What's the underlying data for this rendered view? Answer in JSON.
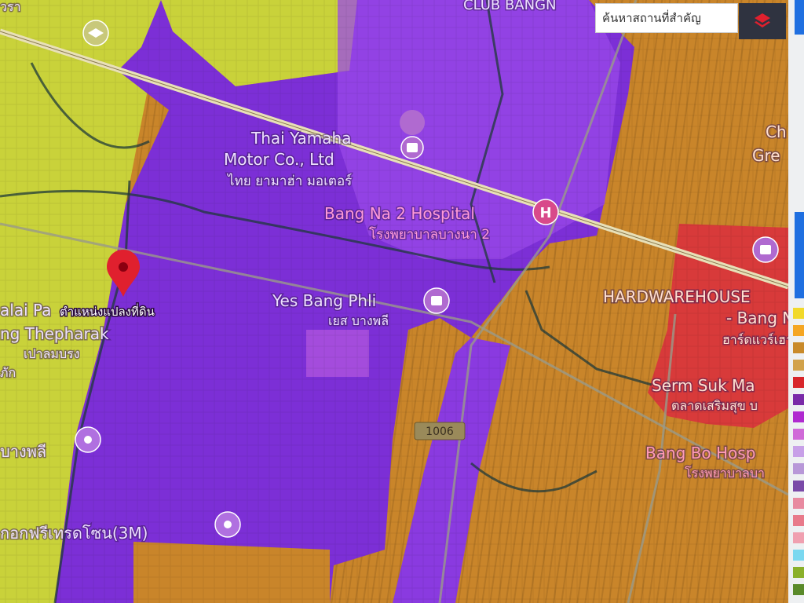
{
  "map": {
    "pin_label": "ตำแหน่งแปลงที่ดิน",
    "road_shield": "1006",
    "places": [
      {
        "id": "yamaha-en",
        "text": "Thai Yamaha"
      },
      {
        "id": "yamaha-en2",
        "text": "Motor Co., Ltd"
      },
      {
        "id": "yamaha-th",
        "text": "ไทย ยามาฮ่า มอเตอร์"
      },
      {
        "id": "bangna-hosp-en",
        "text": "Bang Na 2 Hospital"
      },
      {
        "id": "bangna-hosp-th",
        "text": "โรงพยาบาลบางนา 2"
      },
      {
        "id": "yes-en",
        "text": "Yes Bang Phli"
      },
      {
        "id": "yes-th",
        "text": "เยส บางพลี"
      },
      {
        "id": "hardware-en",
        "text": "HARDWAREHOUSE"
      },
      {
        "id": "hardware-en2",
        "text": "- Bang N"
      },
      {
        "id": "hardware-th",
        "text": "ฮาร์ดแวร์เฮา"
      },
      {
        "id": "sermsuk-en",
        "text": "Serm Suk Ma"
      },
      {
        "id": "sermsuk-th",
        "text": "ตลาดเสริมสุข บ"
      },
      {
        "id": "bangbo-en",
        "text": "Bang Bo Hosp"
      },
      {
        "id": "bangbo-th",
        "text": "โรงพยาบาลบา"
      },
      {
        "id": "palai-en",
        "text": "alai Pa"
      },
      {
        "id": "thepharak-en",
        "text": "ng Thepharak"
      },
      {
        "id": "palai-th",
        "text": "เปาลมบรง"
      },
      {
        "id": "bangphli-th",
        "text": "บางพลี"
      },
      {
        "id": "freezone-th",
        "text": "กอกฟรีเทรดโซน(3M)"
      },
      {
        "id": "club-top",
        "text": "CLUB BANGN"
      },
      {
        "id": "ch-right",
        "text": "Ch"
      },
      {
        "id": "gre-right",
        "text": "Gre"
      },
      {
        "id": "top-left",
        "text": "วรา"
      },
      {
        "id": "left-small",
        "text": "ภัก"
      }
    ]
  },
  "search": {
    "placeholder": "ค้นหาสถานที่สำคัญ"
  },
  "legend": {
    "swatch_colors": [
      "#f2d92a",
      "#f5a623",
      "#c98a2a",
      "#d2a24a",
      "#d8262b",
      "#7a2aa8",
      "#b02ad0",
      "#d06ad8",
      "#c8a0e8",
      "#b898d8",
      "#7a4aa8",
      "#e88aa0",
      "#e87a8a",
      "#f0a0b0",
      "#7ad8f0",
      "#8ab02a",
      "#5a8a2a"
    ]
  },
  "colors": {
    "purple_zone": "#7c2fd6",
    "orange_zone": "#c9852a",
    "yellow_zone": "#c9d23a",
    "red_zone": "#d83a3a",
    "pin": "#e0202e"
  }
}
